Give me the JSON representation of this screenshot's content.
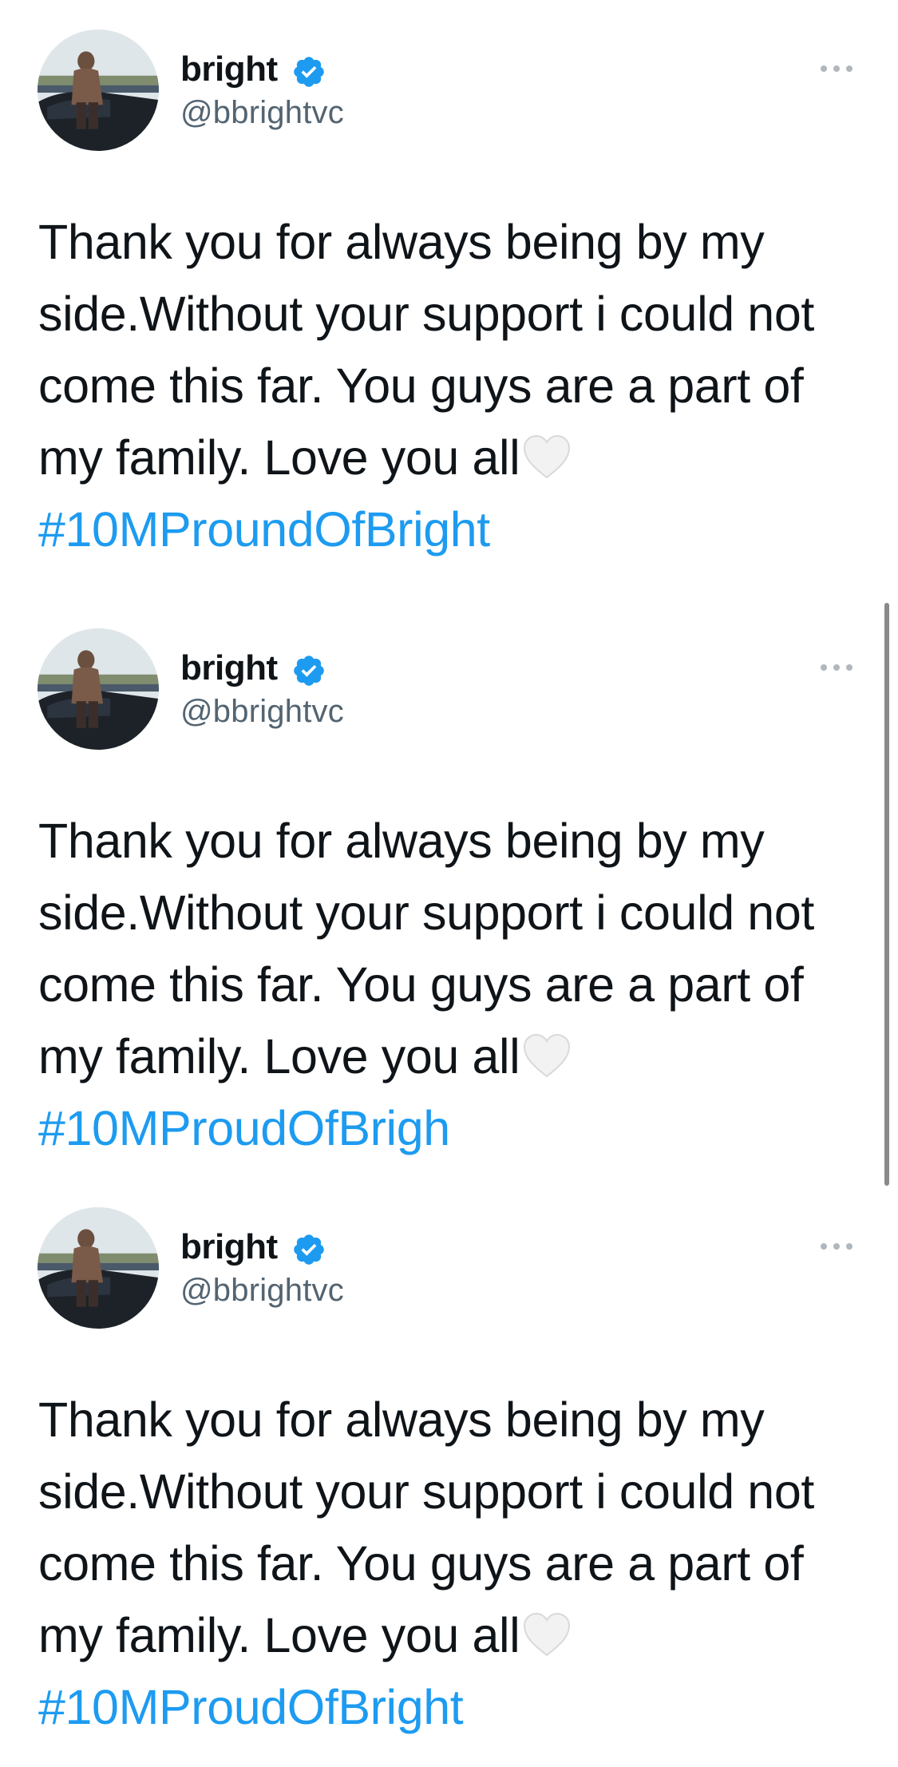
{
  "colors": {
    "text": "#0f1419",
    "secondary_text": "#536471",
    "link": "#1d9bf0",
    "verified_badge": "#1d9bf0",
    "heart": "#f0f0f0"
  },
  "icons": {
    "verified": "verified-badge-icon",
    "more": "more-options-icon",
    "heart": "white-heart-emoji"
  },
  "tweets": [
    {
      "author_name": "bright",
      "author_handle": "@bbrightvc",
      "text_lines": [
        "Thank you for always being by my",
        "side.Without your support i could not",
        "come this far. You guys are a part of",
        "my family. Love you all"
      ],
      "hashtag": "#10MProundOfBright"
    },
    {
      "author_name": "bright",
      "author_handle": "@bbrightvc",
      "text_lines": [
        "Thank you for always being by my",
        "side.Without your support i could not",
        "come this far. You guys are a part of",
        "my family. Love you all"
      ],
      "hashtag": "#10MProudOfBrigh"
    },
    {
      "author_name": "bright",
      "author_handle": "@bbrightvc",
      "text_lines": [
        "Thank you for always being by my",
        "side.Without your support i could not",
        "come this far. You guys are a part of",
        "my family. Love you all"
      ],
      "hashtag": "#10MProudOfBright"
    }
  ]
}
